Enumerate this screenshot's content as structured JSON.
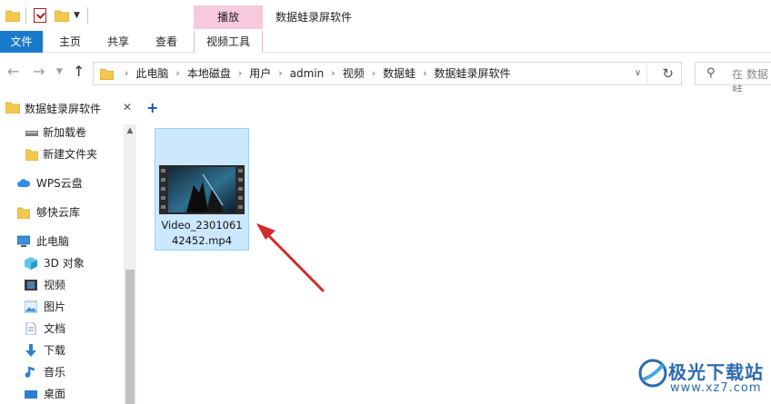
{
  "titlebar": {
    "context_tab_label": "播放",
    "window_title": "数据蛙录屏软件"
  },
  "ribbon": {
    "tabs": [
      {
        "label": "文件"
      },
      {
        "label": "主页"
      },
      {
        "label": "共享"
      },
      {
        "label": "查看"
      },
      {
        "label": "视频工具"
      }
    ]
  },
  "address": {
    "crumbs": [
      "此电脑",
      "本地磁盘",
      "用户",
      "admin",
      "视频",
      "数据蛙",
      "数据蛙录屏软件"
    ],
    "search_placeholder": "在 数据蛙"
  },
  "nav": {
    "header": "数据蛙录屏软件",
    "items": [
      {
        "label": "新加载卷",
        "icon": "drive-icon"
      },
      {
        "label": "新建文件夹",
        "icon": "folder-icon"
      },
      {
        "label": "WPS云盘",
        "icon": "cloud-icon"
      },
      {
        "label": "够快云库",
        "icon": "folder-icon"
      },
      {
        "label": "此电脑",
        "icon": "computer-icon"
      },
      {
        "label": "3D 对象",
        "icon": "cube-icon"
      },
      {
        "label": "视频",
        "icon": "video-icon"
      },
      {
        "label": "图片",
        "icon": "picture-icon"
      },
      {
        "label": "文档",
        "icon": "document-icon"
      },
      {
        "label": "下载",
        "icon": "download-icon"
      },
      {
        "label": "音乐",
        "icon": "music-icon"
      },
      {
        "label": "桌面",
        "icon": "desktop-icon"
      }
    ]
  },
  "content": {
    "file": {
      "name_line1": "Video_2301061",
      "name_line2": "42452.mp4"
    }
  },
  "watermark": {
    "brand": "极光下载站",
    "url": "www.xz7.com"
  },
  "colors": {
    "accent": "#1979ca",
    "selection": "#cce8ff",
    "context_tab": "#f7c9de",
    "arrow": "#d12b2b"
  }
}
